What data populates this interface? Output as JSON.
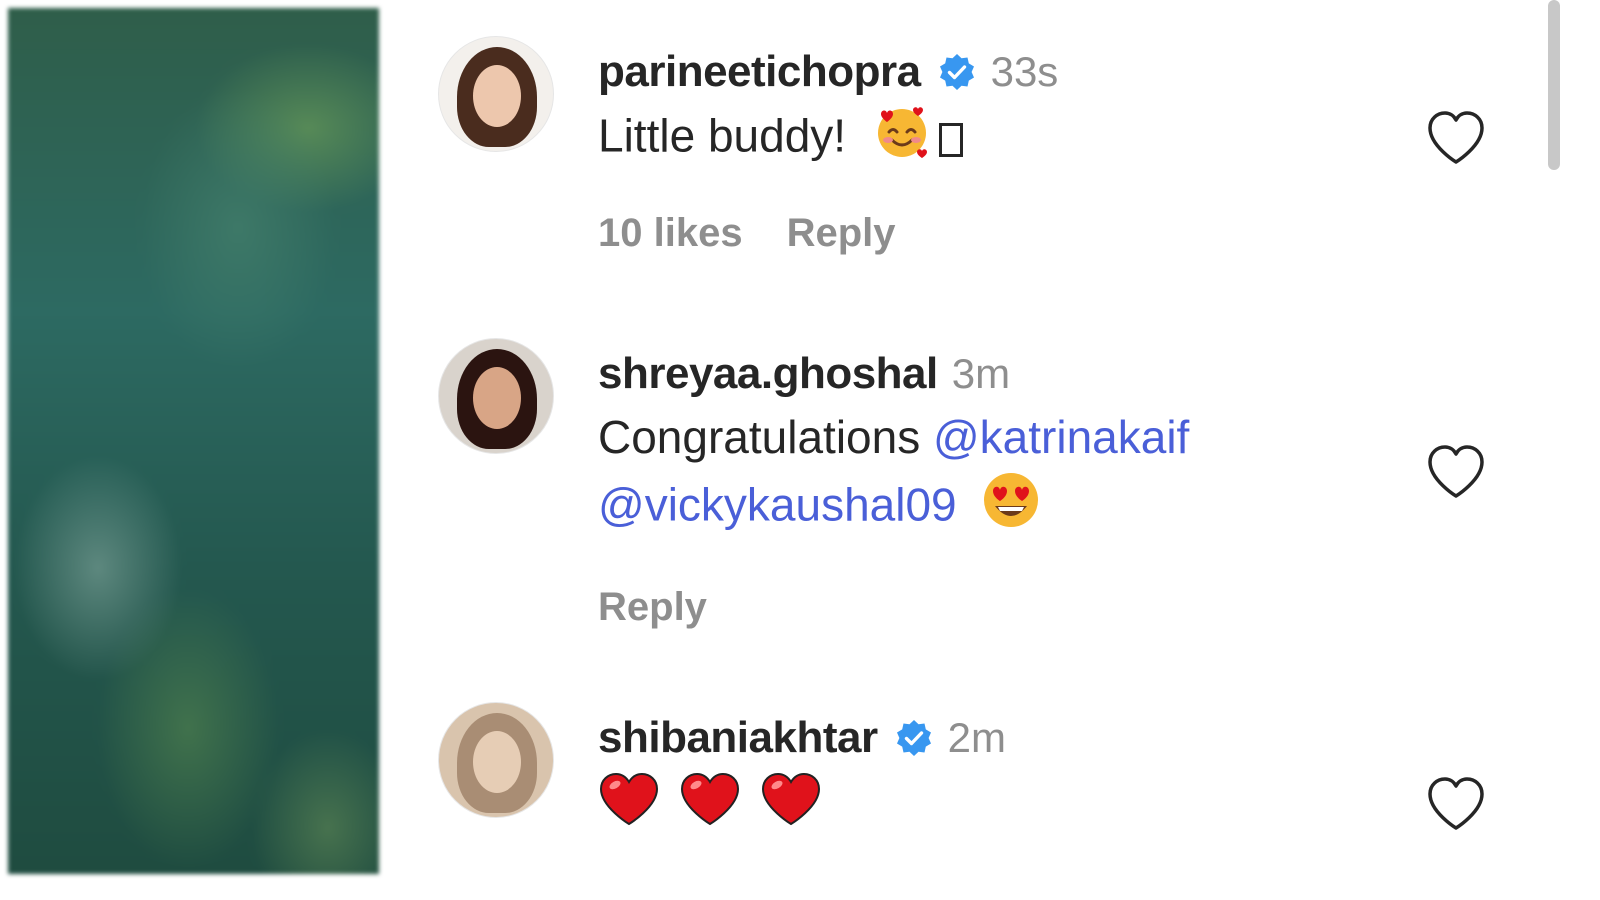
{
  "comments": [
    {
      "username": "parineetichopra",
      "verified": true,
      "time": "33s",
      "text": "Little buddy!",
      "emojis": [
        "smiling-face-with-hearts-emoji",
        "unsupported-glyph-box"
      ],
      "likes": "10 likes",
      "reply": "Reply"
    },
    {
      "username": "shreyaa.ghoshal",
      "verified": false,
      "time": "3m",
      "text": "Congratulations",
      "mentions": [
        "@katrinakaif",
        "@vickykaushal09"
      ],
      "emojis": [
        "heart-eyes-emoji"
      ],
      "reply": "Reply"
    },
    {
      "username": "shibaniakhtar",
      "verified": true,
      "time": "2m",
      "emojis": [
        "red-heart-emoji",
        "red-heart-emoji",
        "red-heart-emoji"
      ]
    }
  ],
  "colors": {
    "verified_badge": "#3897f0",
    "mention": "#4a5fd8",
    "secondary_text": "#8e8e8e",
    "heart_emoji": "#e0121b"
  }
}
